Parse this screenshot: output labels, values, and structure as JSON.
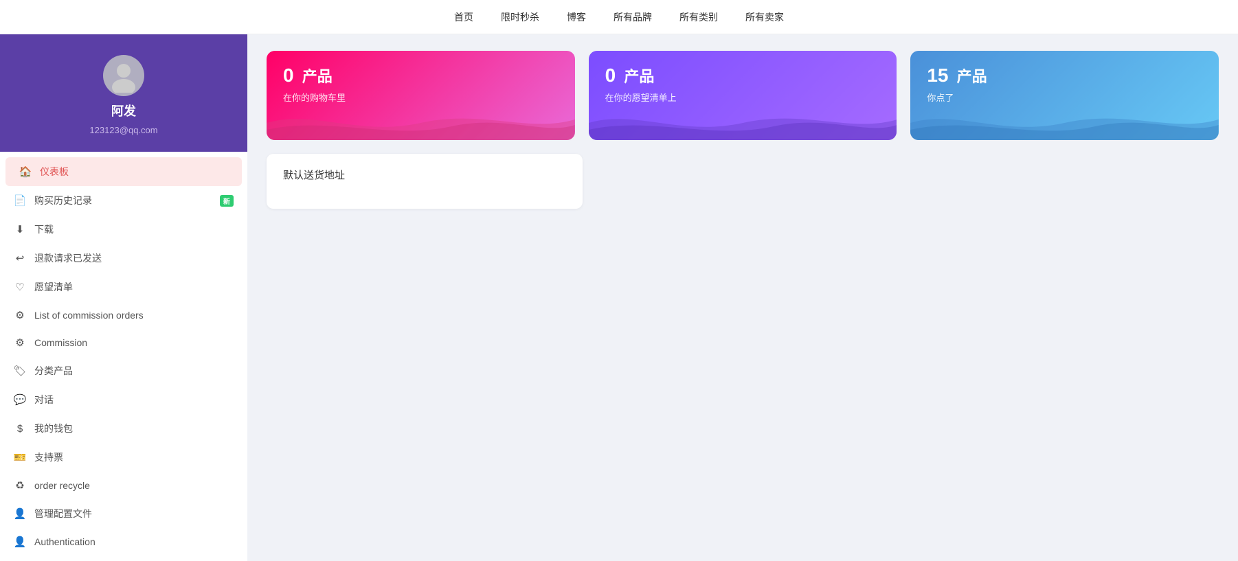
{
  "topnav": {
    "items": [
      {
        "label": "首页",
        "id": "home"
      },
      {
        "label": "限时秒杀",
        "id": "flash-sale"
      },
      {
        "label": "博客",
        "id": "blog"
      },
      {
        "label": "所有品牌",
        "id": "brands"
      },
      {
        "label": "所有类别",
        "id": "categories"
      },
      {
        "label": "所有卖家",
        "id": "sellers"
      }
    ]
  },
  "sidebar": {
    "profile": {
      "name": "阿发",
      "email": "123123@qq.com"
    },
    "nav": [
      {
        "id": "dashboard",
        "label": "仪表板",
        "icon": "home",
        "active": true,
        "badge": null
      },
      {
        "id": "purchase-history",
        "label": "购买历史记录",
        "icon": "file",
        "active": false,
        "badge": "新"
      },
      {
        "id": "downloads",
        "label": "下载",
        "icon": "download",
        "active": false,
        "badge": null
      },
      {
        "id": "refund",
        "label": "退款请求已发送",
        "icon": "refund",
        "active": false,
        "badge": null
      },
      {
        "id": "wishlist",
        "label": "愿望清单",
        "icon": "heart",
        "active": false,
        "badge": null
      },
      {
        "id": "commission-orders",
        "label": "List of commission orders",
        "icon": "settings",
        "active": false,
        "badge": null
      },
      {
        "id": "commission",
        "label": "Commission",
        "icon": "settings2",
        "active": false,
        "badge": null
      },
      {
        "id": "classified-products",
        "label": "分类产品",
        "icon": "tag",
        "active": false,
        "badge": null
      },
      {
        "id": "conversation",
        "label": "对话",
        "icon": "chat",
        "active": false,
        "badge": null
      },
      {
        "id": "wallet",
        "label": "我的钱包",
        "icon": "dollar",
        "active": false,
        "badge": null
      },
      {
        "id": "support",
        "label": "支持票",
        "icon": "support",
        "active": false,
        "badge": null
      },
      {
        "id": "order-recycle",
        "label": "order recycle",
        "icon": "recycle",
        "active": false,
        "badge": null
      },
      {
        "id": "manage-profile",
        "label": "管理配置文件",
        "icon": "user-manage",
        "active": false,
        "badge": null
      },
      {
        "id": "authentication",
        "label": "Authentication",
        "icon": "user-auth",
        "active": false,
        "badge": null
      }
    ]
  },
  "stats": [
    {
      "number": "0",
      "label": "产品",
      "sub": "在你的购物车里",
      "theme": "pink"
    },
    {
      "number": "0",
      "label": "产品",
      "sub": "在你的愿望清单上",
      "theme": "purple"
    },
    {
      "number": "15",
      "label": "产品",
      "sub": "你点了",
      "theme": "blue"
    }
  ],
  "address": {
    "title": "默认送货地址"
  }
}
